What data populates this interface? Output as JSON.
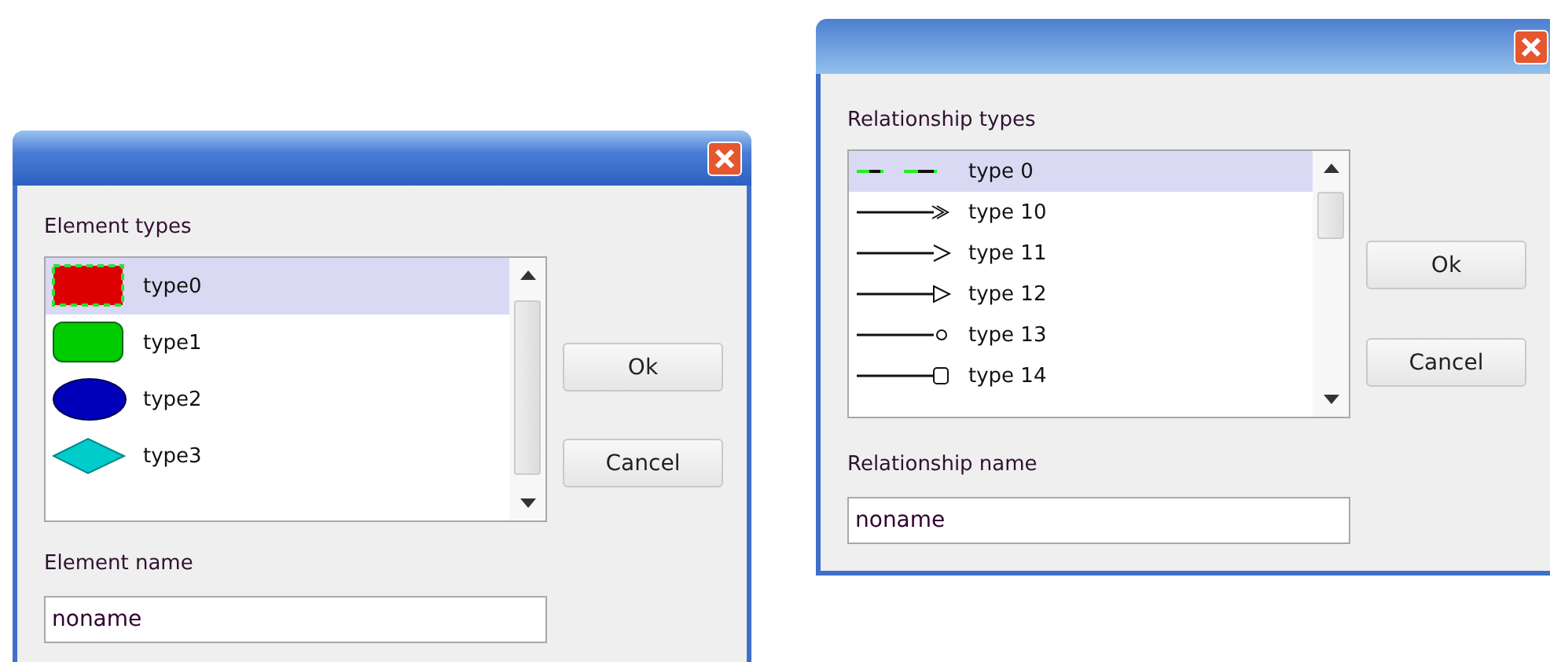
{
  "dialogs": [
    {
      "list_label": "Element types",
      "name_label": "Element name",
      "name_value": "noname",
      "buttons": [
        "Ok",
        "Cancel"
      ],
      "items": [
        {
          "label": "type0",
          "kind": "rect",
          "color": "#dd0000",
          "selected": true
        },
        {
          "label": "type1",
          "kind": "rounded",
          "color": "#00cc00",
          "selected": false
        },
        {
          "label": "type2",
          "kind": "ellipse",
          "color": "#0000bb",
          "selected": false
        },
        {
          "label": "type3",
          "kind": "diamond",
          "color": "#00cccc",
          "selected": false
        }
      ]
    },
    {
      "list_label": "Relationship types",
      "name_label": "Relationship name",
      "name_value": "noname",
      "buttons": [
        "Ok",
        "Cancel"
      ],
      "items": [
        {
          "label": "type 0",
          "kind": "dashed",
          "selected": true
        },
        {
          "label": "type 10",
          "kind": "double-arrow",
          "selected": false
        },
        {
          "label": "type 11",
          "kind": "open-arrow",
          "selected": false
        },
        {
          "label": "type 12",
          "kind": "triangle",
          "selected": false
        },
        {
          "label": "type 13",
          "kind": "circle",
          "selected": false
        },
        {
          "label": "type 14",
          "kind": "square",
          "selected": false
        }
      ]
    }
  ]
}
